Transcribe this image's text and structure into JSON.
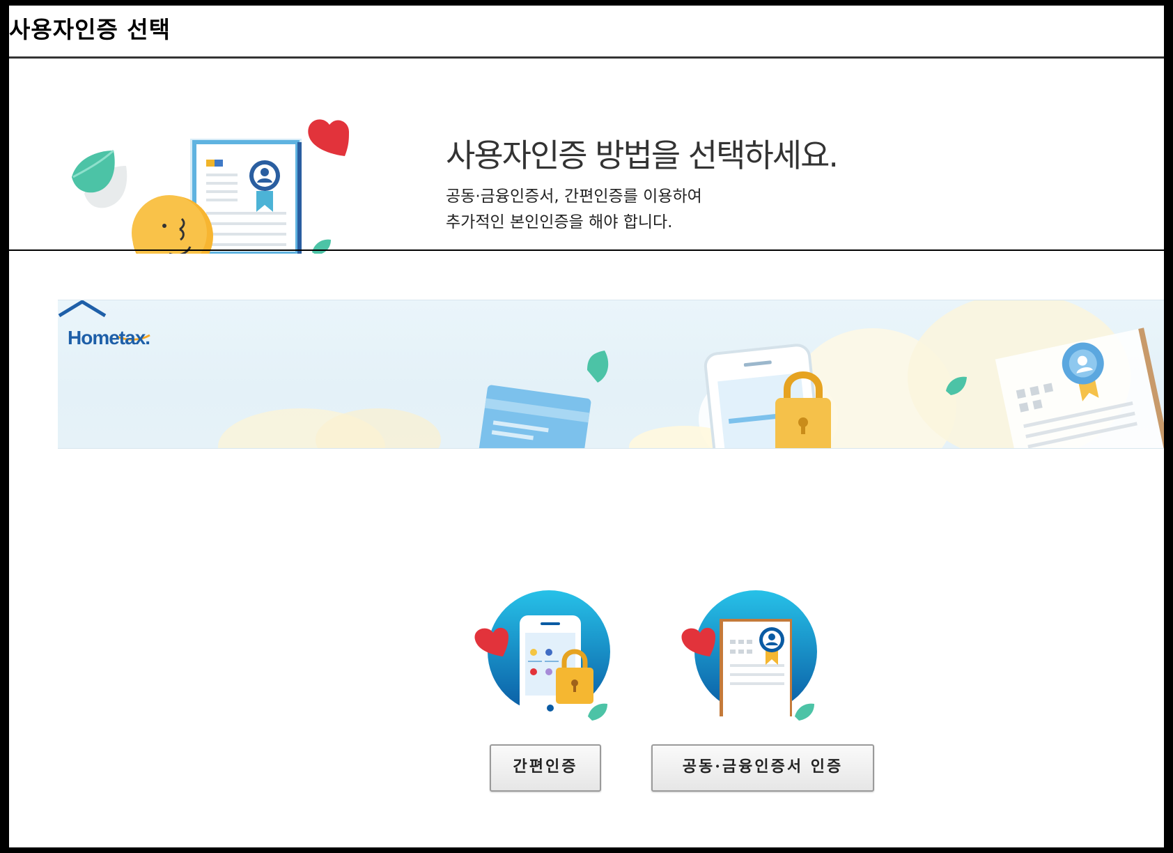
{
  "window": {
    "title": "사용자인증 선택"
  },
  "intro": {
    "heading": "사용자인증 방법을 선택하세요.",
    "desc_line1": "공동·금융인증서, 간편인증를 이용하여",
    "desc_line2": "추가적인 본인인증을 해야 합니다."
  },
  "banner": {
    "logo_text": "Hometax."
  },
  "options": [
    {
      "label": "간편인증",
      "icon": "mobile-lock-icon"
    },
    {
      "label": "공동·금융인증서 인증",
      "icon": "certificate-icon"
    }
  ],
  "colors": {
    "title_rule": "#333333",
    "brand_blue": "#1e5fa8",
    "heart": "#e2333b",
    "leaf": "#4cc3a6",
    "lock": "#f5b731"
  }
}
